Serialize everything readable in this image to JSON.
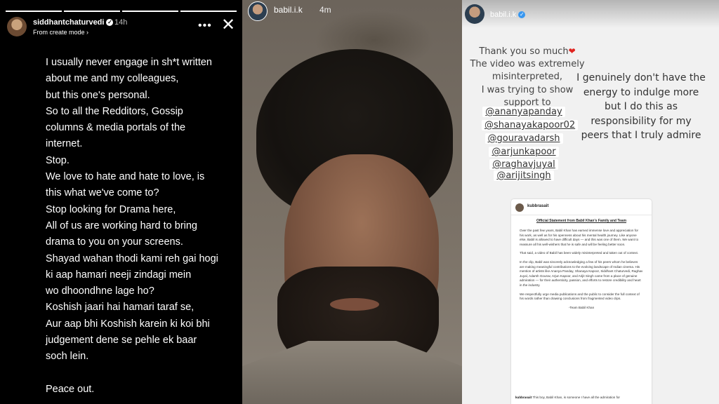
{
  "panel1": {
    "username": "siddhantchaturvedi",
    "time": "14h",
    "subtitle": "From create mode",
    "subtitle_chevron": "›",
    "verified_mark": "✓",
    "more_icon": "•••",
    "close_icon": "✕",
    "lines": [
      "I usually never engage in sh*t written",
      "about me and my colleagues,",
      "but this one's personal.",
      "So to all the Redditors, Gossip",
      "columns & media portals of the",
      "internet.",
      "Stop.",
      "We love to hate and hate to love, is",
      "this what we've come to?",
      "Stop looking for Drama here,",
      "All of us are working hard to bring",
      "drama to you on your screens.",
      "Shayad wahan thodi kami reh gai hogi",
      "ki aap hamari neeji zindagi mein",
      "wo dhoondhne lage ho?",
      "Koshish jaari hai hamari taraf se,",
      "Aur aap bhi Koshish karein ki koi bhi",
      "judgement dene se pehle ek baar",
      "soch lein.",
      "",
      "Peace out."
    ]
  },
  "panel2": {
    "username": "babil.i.k",
    "time": "4m"
  },
  "panel3": {
    "username": "babil.i.k",
    "verified_mark": "✓",
    "thanks_lines": [
      "Thank you so much",
      "The  video was extremely",
      "misinterpreted,",
      "I was trying to show",
      "support to"
    ],
    "heart": "❤",
    "mentions": [
      "@ananyapanday",
      "@shanayakapoor02",
      "@gouravadarsh",
      "@arjunkapoor",
      "@raghavjuyal",
      "@arijitsingh"
    ],
    "energy_lines": [
      "I genuinely don't have the",
      "energy to indulge more",
      "but I do this as",
      "responsibility for my",
      "peers that I truly admire"
    ],
    "card": {
      "user": "kubbrasait",
      "title": "Official Statement from Babil Khan's Family and Team",
      "paragraphs": [
        "Over the past few years, Babil Khan has earned immense love and appreciation for his work, as well as for his openness about his mental health journey. Like anyone else, Babil is allowed to have difficult days — and this was one of them. We want to reassure all his well-wishers that he is safe and will be feeling better soon.",
        "That said, a video of Babil has been widely misinterpreted and taken out of context.",
        "In the clip, Babil was sincerely acknowledging a few of his peers whom he believes are making meaningful contributions to the evolving landscape of Indian cinema. His mention of artists like Ananya Panday, Shanaya Kapoor, Siddhant Chaturvedi, Raghav Juyal, Adarsh Gourav, Arjun Kapoor, and Arijit Singh came from a place of genuine admiration — for their authenticity, passion, and efforts to restore credibility and heart in the industry.",
        "We respectfully urge media publications and the public to consider the full context of his words rather than drawing conclusions from fragmented video clips."
      ],
      "signature": "-Team Babil Khan",
      "footer_user": "kubbrasait",
      "footer_text": "This boy, Babil Khan, is someone I have all the admiration for"
    }
  }
}
